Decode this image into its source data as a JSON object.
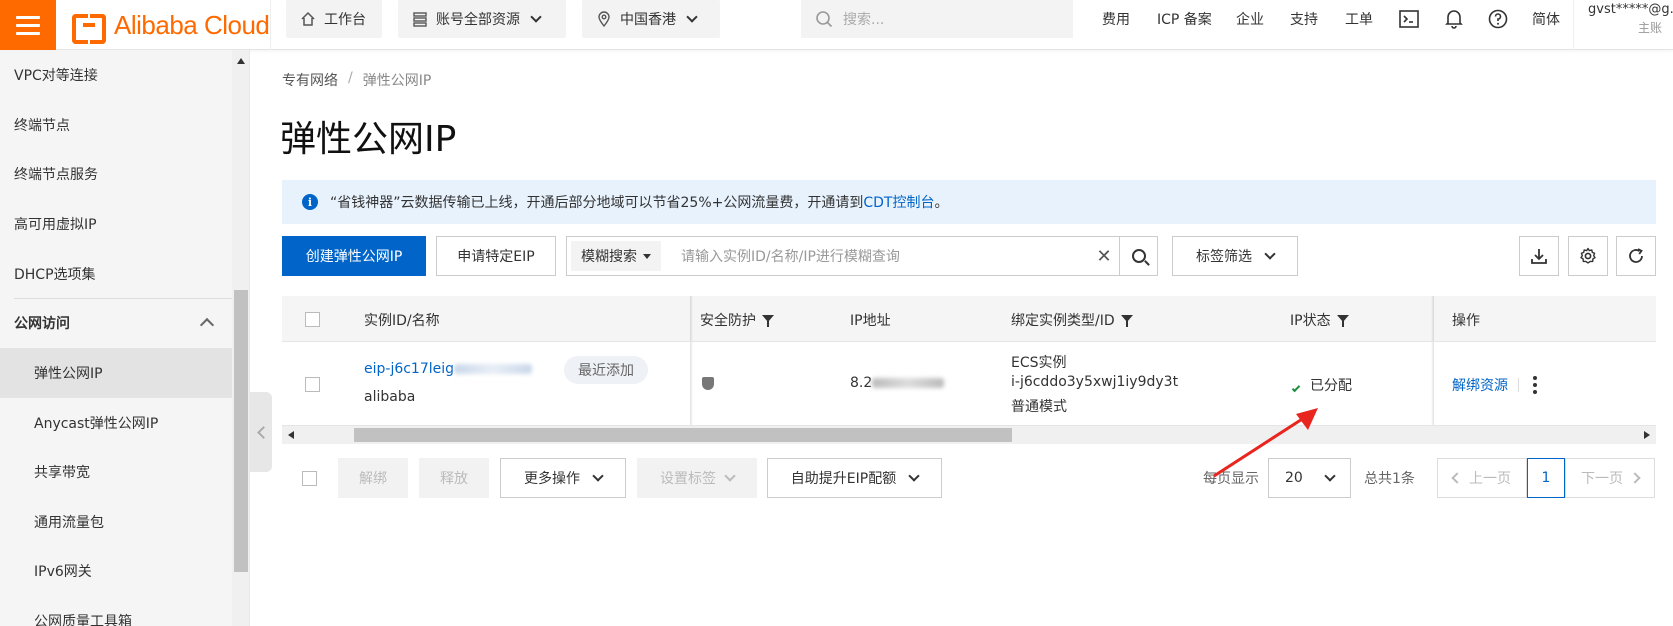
{
  "brand": {
    "name": "Alibaba Cloud",
    "accent": "#ff6a00"
  },
  "topbar": {
    "workbench": "工作台",
    "resources": "账号全部资源",
    "region": "中国香港",
    "search_placeholder": "搜索...",
    "nav": [
      "费用",
      "ICP 备案",
      "企业",
      "支持",
      "工单"
    ],
    "language": "简体",
    "user_name": "gvst*****@g...",
    "user_sub": "主账"
  },
  "sidebar": {
    "items": [
      {
        "label": "VPC对等连接"
      },
      {
        "label": "终端节点"
      },
      {
        "label": "终端节点服务"
      },
      {
        "label": "高可用虚拟IP"
      },
      {
        "label": "DHCP选项集"
      }
    ],
    "group_label": "公网访问",
    "sub_items": [
      {
        "label": "弹性公网IP",
        "active": true
      },
      {
        "label": "Anycast弹性公网IP"
      },
      {
        "label": "共享带宽"
      },
      {
        "label": "通用流量包"
      },
      {
        "label": "IPv6网关"
      },
      {
        "label": "公网质量工具箱"
      }
    ]
  },
  "breadcrumb": {
    "parent": "专有网络",
    "separator": "/",
    "current": "弹性公网IP"
  },
  "page_title": "弹性公网IP",
  "notice": {
    "text": "“省钱神器”云数据传输已上线，开通后部分地域可以节省25%+公网流量费，开通请到",
    "link": "CDT控制台",
    "end": "。"
  },
  "toolbar": {
    "create_label": "创建弹性公网IP",
    "apply_label": "申请特定EIP",
    "search_mode": "模糊搜索",
    "search_placeholder": "请输入实例ID/名称/IP进行模糊查询",
    "tag_filter": "标签筛选"
  },
  "table": {
    "headers": {
      "instance": "实例ID/名称",
      "security": "安全防护",
      "ip": "IP地址",
      "bound": "绑定实例类型/ID",
      "status": "IP状态",
      "actions": "操作"
    },
    "rows": [
      {
        "id": "eip-j6c17leig",
        "name": "alibaba",
        "tag": "最近添加",
        "ip": "8.2",
        "bound_type": "ECS实例",
        "bound_id": "i-j6cddo3y5xwj1iy9dy3t",
        "bound_mode": "普通模式",
        "status": "已分配",
        "action": "解绑资源"
      }
    ]
  },
  "footer": {
    "unbind": "解绑",
    "release": "释放",
    "more": "更多操作",
    "set_tag": "设置标签",
    "quota": "自助提升EIP配额",
    "per_page_label": "每页显示",
    "per_page": "20",
    "total": "总共1条",
    "prev": "上一页",
    "page": "1",
    "next": "下一页"
  },
  "colors": {
    "primary": "#0064c8",
    "success": "#1e8e3e",
    "annotation": "#e8251f"
  }
}
